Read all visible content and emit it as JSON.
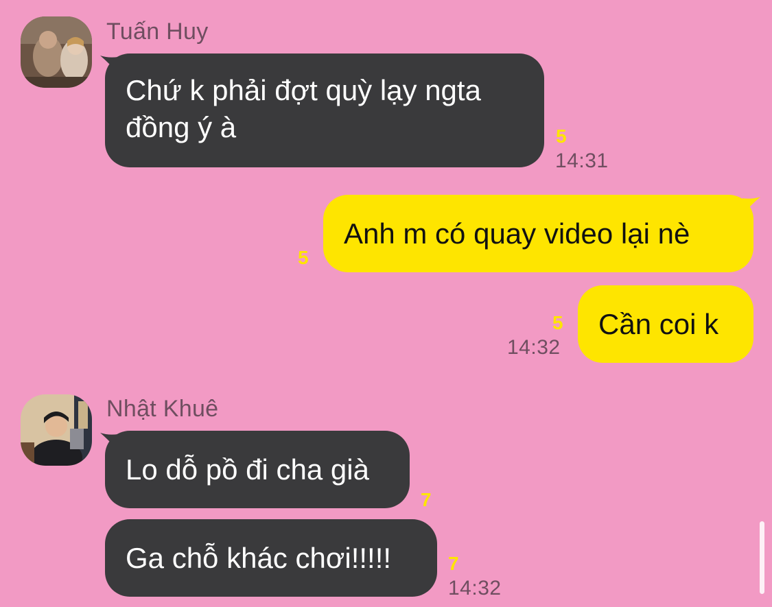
{
  "colors": {
    "background": "#F29AC4",
    "incoming_bubble": "#3A3A3C",
    "outgoing_bubble": "#FEE500",
    "unread_count": "#FEE500",
    "meta_text": "#6F4E60"
  },
  "messages": {
    "group1": {
      "sender": "Tuấn Huy",
      "avatar_icon": "user-photo-avatar",
      "bubble1": {
        "line1": "Chứ k phải đợt quỳ lạy ngta",
        "line2": "đồng ý à",
        "unread": "5",
        "time": "14:31"
      }
    },
    "group2": {
      "bubble1": {
        "text": "Anh m có quay video lại nè",
        "unread": "5"
      },
      "bubble2": {
        "text": "Cần coi k",
        "unread": "5",
        "time": "14:32"
      }
    },
    "group3": {
      "sender": "Nhật Khuê",
      "avatar_icon": "user-photo-avatar",
      "bubble1": {
        "text": "Lo dỗ pồ đi cha già",
        "unread": "7"
      },
      "bubble2": {
        "text": "Ga chỗ khác chơi!!!!!",
        "unread": "7",
        "time": "14:32"
      }
    }
  }
}
